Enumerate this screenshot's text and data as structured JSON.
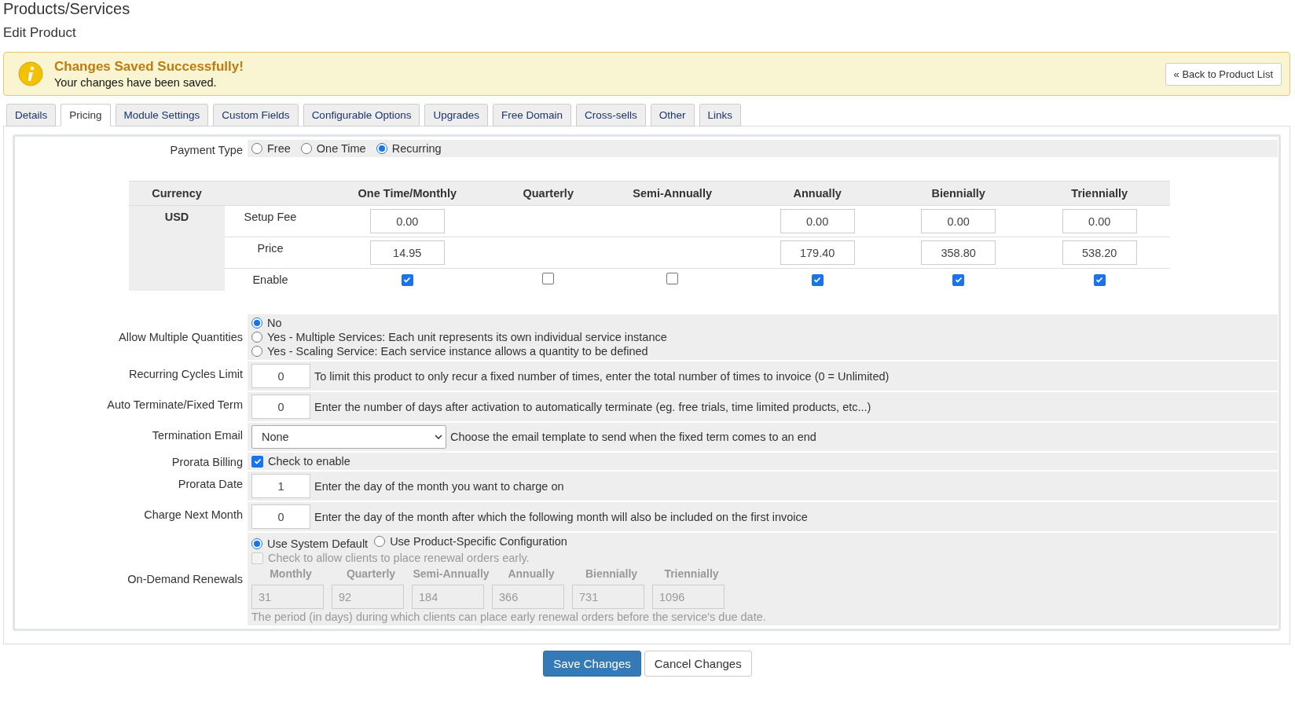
{
  "page_title": "Products/Services",
  "subtitle": "Edit Product",
  "alert": {
    "title": "Changes Saved Successfully!",
    "message": "Your changes have been saved.",
    "button": "« Back to Product List"
  },
  "tabs": [
    {
      "label": "Details",
      "selected": false
    },
    {
      "label": "Pricing",
      "selected": true
    },
    {
      "label": "Module Settings",
      "selected": false
    },
    {
      "label": "Custom Fields",
      "selected": false
    },
    {
      "label": "Configurable Options",
      "selected": false
    },
    {
      "label": "Upgrades",
      "selected": false
    },
    {
      "label": "Free Domain",
      "selected": false
    },
    {
      "label": "Cross-sells",
      "selected": false
    },
    {
      "label": "Other",
      "selected": false
    },
    {
      "label": "Links",
      "selected": false
    }
  ],
  "payment_type": {
    "label": "Payment Type",
    "options": [
      {
        "label": "Free",
        "selected": false
      },
      {
        "label": "One Time",
        "selected": false
      },
      {
        "label": "Recurring",
        "selected": true
      }
    ]
  },
  "pricing": {
    "currency_header": "Currency",
    "currency": "USD",
    "row_labels": [
      "Setup Fee",
      "Price",
      "Enable"
    ],
    "cycles": [
      {
        "label": "One Time/Monthly",
        "setup_fee": "0.00",
        "price": "14.95",
        "enabled": true
      },
      {
        "label": "Quarterly",
        "enabled": false
      },
      {
        "label": "Semi-Annually",
        "enabled": false
      },
      {
        "label": "Annually",
        "setup_fee": "0.00",
        "price": "179.40",
        "enabled": true
      },
      {
        "label": "Biennially",
        "setup_fee": "0.00",
        "price": "358.80",
        "enabled": true
      },
      {
        "label": "Triennially",
        "setup_fee": "0.00",
        "price": "538.20",
        "enabled": true
      }
    ]
  },
  "fields": [
    {
      "kind": "radio",
      "label": "Allow Multiple Quantities",
      "options": [
        {
          "label": "No",
          "selected": true
        },
        {
          "label": "Yes - Multiple Services: Each unit represents its own individual service instance",
          "selected": false
        },
        {
          "label": "Yes - Scaling Service: Each service instance allows a quantity to be defined",
          "selected": false
        }
      ]
    },
    {
      "kind": "number",
      "label": "Recurring Cycles Limit",
      "value": "0",
      "help": "To limit this product to only recur a fixed number of times, enter the total number of times to invoice (0 = Unlimited)"
    },
    {
      "kind": "number",
      "label": "Auto Terminate/Fixed Term",
      "value": "0",
      "help": "Enter the number of days after activation to automatically terminate (eg. free trials, time limited products, etc...)"
    },
    {
      "kind": "select",
      "label": "Termination Email",
      "value": "None",
      "help": "Choose the email template to send when the fixed term comes to an end"
    },
    {
      "kind": "checkbox",
      "label": "Prorata Billing",
      "checked": true,
      "help": "Check to enable"
    },
    {
      "kind": "number",
      "label": "Prorata Date",
      "value": "1",
      "help": "Enter the day of the month you want to charge on"
    },
    {
      "kind": "number",
      "label": "Charge Next Month",
      "value": "0",
      "help": "Enter the day of the month after which the following month will also be included on the first invoice"
    },
    {
      "kind": "renewals",
      "label": "On-Demand Renewals",
      "options": [
        {
          "label": "Use System Default",
          "selected": true
        },
        {
          "label": "Use Product-Specific Configuration",
          "selected": false
        }
      ],
      "early": {
        "label": "Check to allow clients to place renewal orders early.",
        "checked": false,
        "disabled": true
      },
      "periods": [
        {
          "label": "Monthly",
          "value": "31"
        },
        {
          "label": "Quarterly",
          "value": "92"
        },
        {
          "label": "Semi-Annually",
          "value": "184"
        },
        {
          "label": "Annually",
          "value": "366"
        },
        {
          "label": "Biennially",
          "value": "731"
        },
        {
          "label": "Triennially",
          "value": "1096"
        }
      ],
      "help": "The period (in days) during which clients can place early renewal orders before the service's due date."
    }
  ],
  "buttons": {
    "save": "Save Changes",
    "cancel": "Cancel Changes"
  }
}
